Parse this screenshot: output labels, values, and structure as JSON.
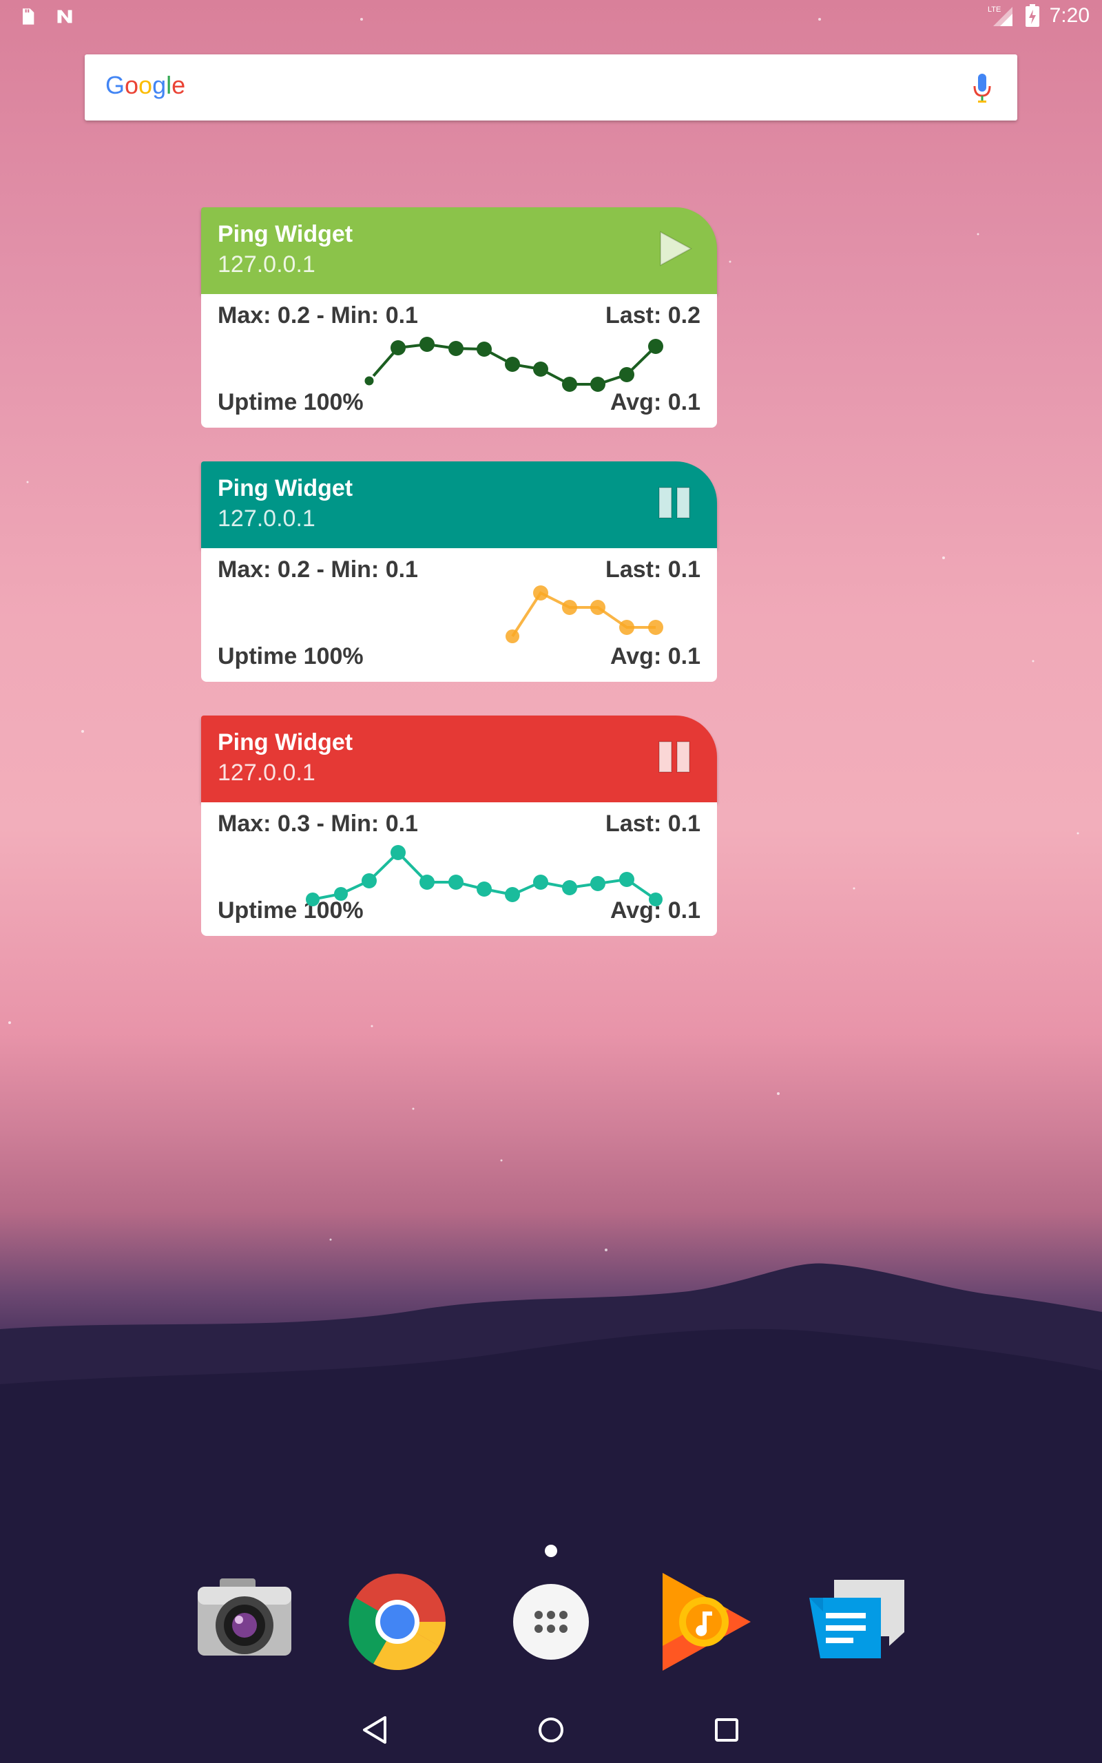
{
  "status_bar": {
    "time": "7:20",
    "left_icons": [
      "sd-card-icon",
      "n-notification-icon"
    ],
    "right_icons": [
      "lte-signal-icon",
      "battery-charging-icon"
    ],
    "network_label": "LTE"
  },
  "search": {
    "logo_text": "Google",
    "mic_icon": "mic-icon"
  },
  "widgets": [
    {
      "title": "Ping Widget",
      "host": "127.0.0.1",
      "header_color": "#8bc34a",
      "button_icon": "play-icon",
      "max_min": "Max: 0.2 - Min: 0.1",
      "last": "Last: 0.2",
      "uptime": "Uptime 100%",
      "avg": "Avg: 0.1",
      "line_color": "#1b5e20"
    },
    {
      "title": "Ping Widget",
      "host": "127.0.0.1",
      "header_color": "#009688",
      "button_icon": "pause-icon",
      "max_min": "Max: 0.2 - Min: 0.1",
      "last": "Last: 0.1",
      "uptime": "Uptime 100%",
      "avg": "Avg: 0.1",
      "line_color": "#f9a825"
    },
    {
      "title": "Ping Widget",
      "host": "127.0.0.1",
      "header_color": "#e53935",
      "button_icon": "pause-icon",
      "max_min": "Max: 0.3 - Min: 0.1",
      "last": "Last: 0.1",
      "uptime": "Uptime 100%",
      "avg": "Avg: 0.1",
      "line_color": "#1abc9c"
    }
  ],
  "dock": {
    "apps": [
      "camera-app-icon",
      "chrome-app-icon",
      "app-drawer-icon",
      "play-music-app-icon",
      "messages-app-icon"
    ]
  },
  "nav": {
    "buttons": [
      "back-icon",
      "home-icon",
      "recents-icon"
    ]
  }
}
